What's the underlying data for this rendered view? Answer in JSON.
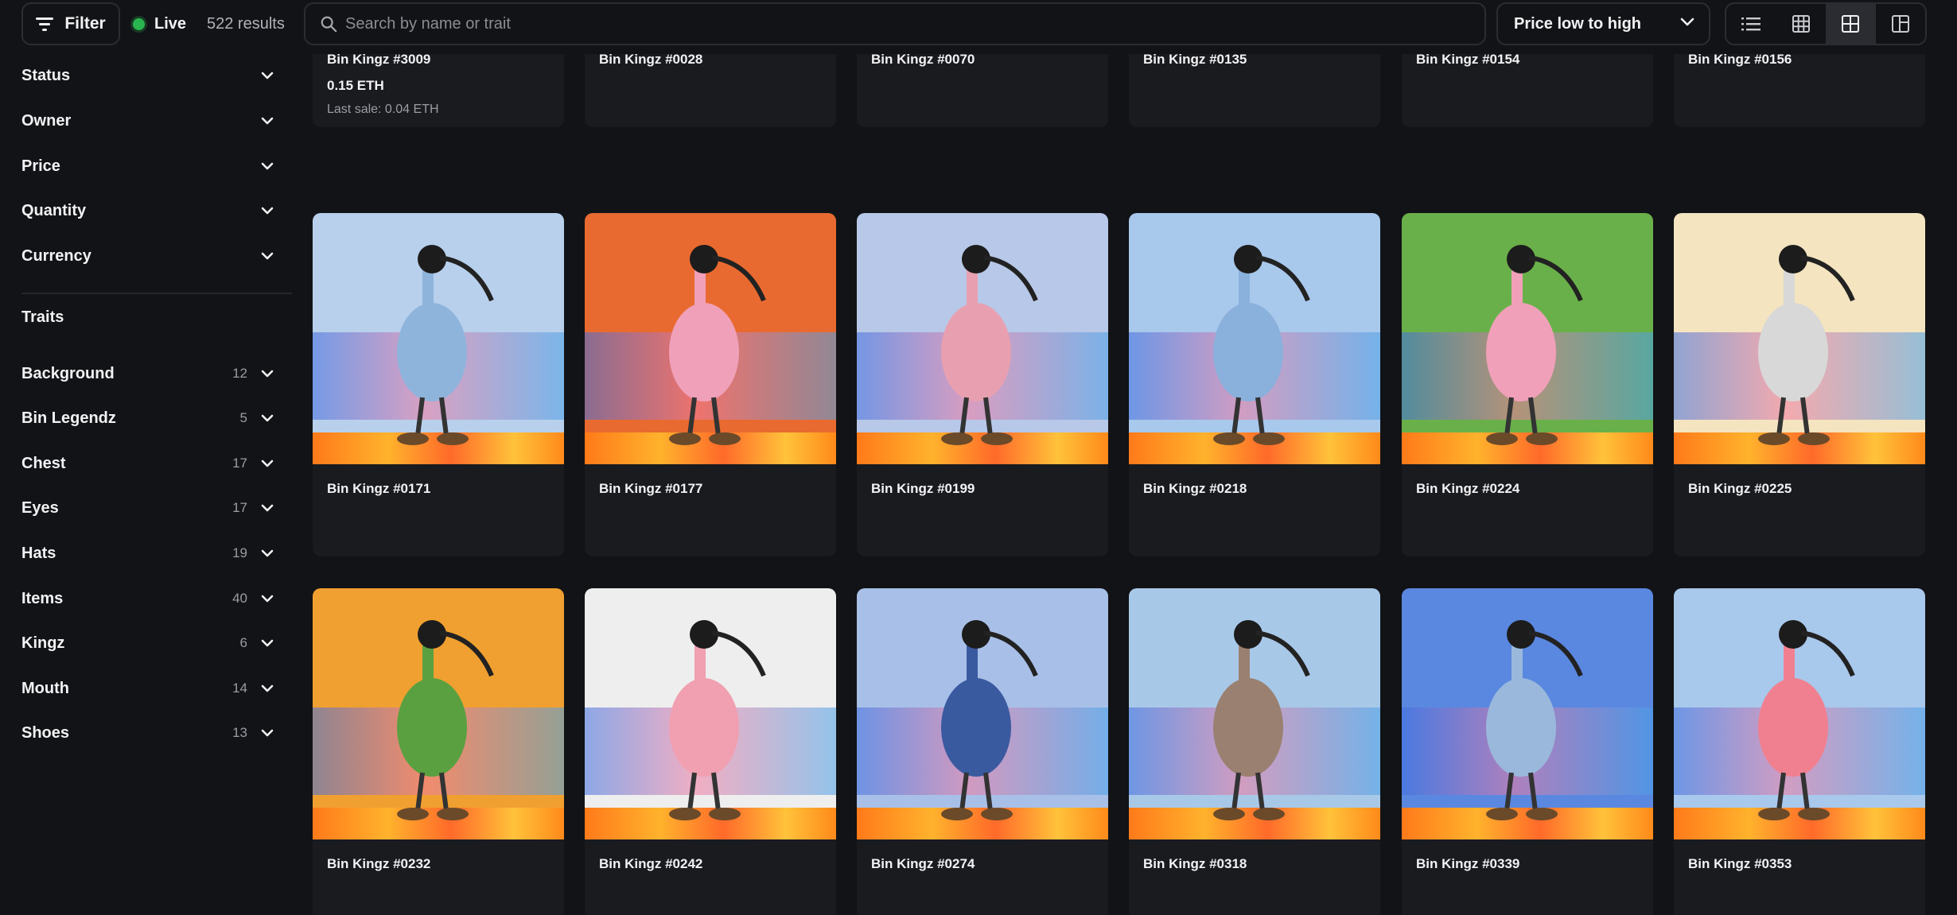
{
  "toolbar": {
    "filter_label": "Filter",
    "live_label": "Live",
    "results_label": "522 results",
    "search_placeholder": "Search by name or trait",
    "sort_value": "Price low to high"
  },
  "sidebar": {
    "filters": [
      {
        "label": "Status"
      },
      {
        "label": "Owner"
      },
      {
        "label": "Price"
      },
      {
        "label": "Quantity"
      },
      {
        "label": "Currency"
      }
    ],
    "traits_title": "Traits",
    "traits": [
      {
        "label": "Background",
        "count": "12"
      },
      {
        "label": "Bin Legendz",
        "count": "5"
      },
      {
        "label": "Chest",
        "count": "17"
      },
      {
        "label": "Eyes",
        "count": "17"
      },
      {
        "label": "Hats",
        "count": "19"
      },
      {
        "label": "Items",
        "count": "40"
      },
      {
        "label": "Kingz",
        "count": "6"
      },
      {
        "label": "Mouth",
        "count": "14"
      },
      {
        "label": "Shoes",
        "count": "13"
      }
    ]
  },
  "items": [
    {
      "name": "Bin Kingz #3009",
      "price": "0.15 ETH",
      "last_sale": "Last sale: 0.04 ETH",
      "bg": "#e8c8a0",
      "body": "#3a8a3a"
    },
    {
      "name": "Bin Kingz #0028",
      "bg": "#2ab0d8",
      "body": "#6b3a22"
    },
    {
      "name": "Bin Kingz #0070",
      "bg": "#f0a030",
      "body": "#c8d040"
    },
    {
      "name": "Bin Kingz #0135",
      "bg": "#f09a20",
      "body": "#d0d0d0"
    },
    {
      "name": "Bin Kingz #0154",
      "bg": "#4a78e0",
      "body": "#5a3a28"
    },
    {
      "name": "Bin Kingz #0156",
      "bg": "#f0b030",
      "body": "#f0f0f0"
    },
    {
      "name": "Bin Kingz #0171",
      "bg": "#b8d0ec",
      "body": "#8fb4dc"
    },
    {
      "name": "Bin Kingz #0177",
      "bg": "#e86a30",
      "body": "#f0a0b8"
    },
    {
      "name": "Bin Kingz #0199",
      "bg": "#b8c8e8",
      "body": "#e8a0b0"
    },
    {
      "name": "Bin Kingz #0218",
      "bg": "#a8c8ec",
      "body": "#8ab0dc"
    },
    {
      "name": "Bin Kingz #0224",
      "bg": "#6ab04a",
      "body": "#f0a0b8"
    },
    {
      "name": "Bin Kingz #0225",
      "bg": "#f4e4c0",
      "body": "#d8d8d8"
    },
    {
      "name": "Bin Kingz #0232",
      "bg": "#f0a030",
      "body": "#5aa040"
    },
    {
      "name": "Bin Kingz #0242",
      "bg": "#eeeeee",
      "body": "#f0a0b0"
    },
    {
      "name": "Bin Kingz #0274",
      "bg": "#a8c0e8",
      "body": "#3a5aa0"
    },
    {
      "name": "Bin Kingz #0318",
      "bg": "#a8c8e8",
      "body": "#9a8070"
    },
    {
      "name": "Bin Kingz #0339",
      "bg": "#5a88e0",
      "body": "#9ab8dc"
    },
    {
      "name": "Bin Kingz #0353",
      "bg": "#a8c8ec",
      "body": "#f08090"
    }
  ]
}
